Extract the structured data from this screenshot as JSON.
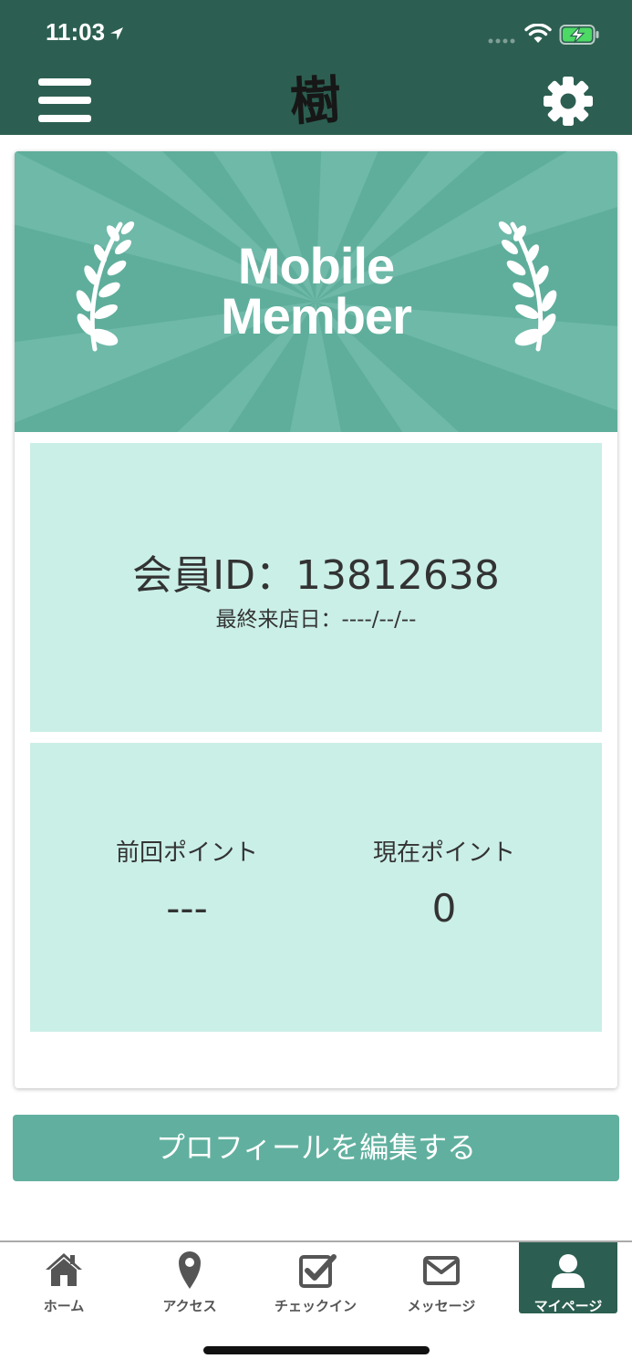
{
  "status_bar": {
    "time": "11:03"
  },
  "header": {
    "logo_text": "樹"
  },
  "banner": {
    "title_line1": "Mobile",
    "title_line2": "Member"
  },
  "member": {
    "id_text": "会員ID：13812638",
    "last_visit_text": "最終来店日：----/--/--"
  },
  "points": {
    "previous": {
      "label": "前回ポイント",
      "value": "---"
    },
    "current": {
      "label": "現在ポイント",
      "value": "0"
    }
  },
  "edit_profile_label": "プロフィールを編集する",
  "tabs": [
    {
      "label": "ホーム",
      "icon": "home-icon"
    },
    {
      "label": "アクセス",
      "icon": "map-pin-icon"
    },
    {
      "label": "チェックイン",
      "icon": "check-square-icon"
    },
    {
      "label": "メッセージ",
      "icon": "envelope-icon"
    },
    {
      "label": "マイページ",
      "icon": "user-icon",
      "active": true
    }
  ],
  "colors": {
    "header": "#2c5f51",
    "banner": "#5fae9c",
    "panel": "#caefe7",
    "button": "#61b09f",
    "active_tab": "#2c5f51"
  }
}
